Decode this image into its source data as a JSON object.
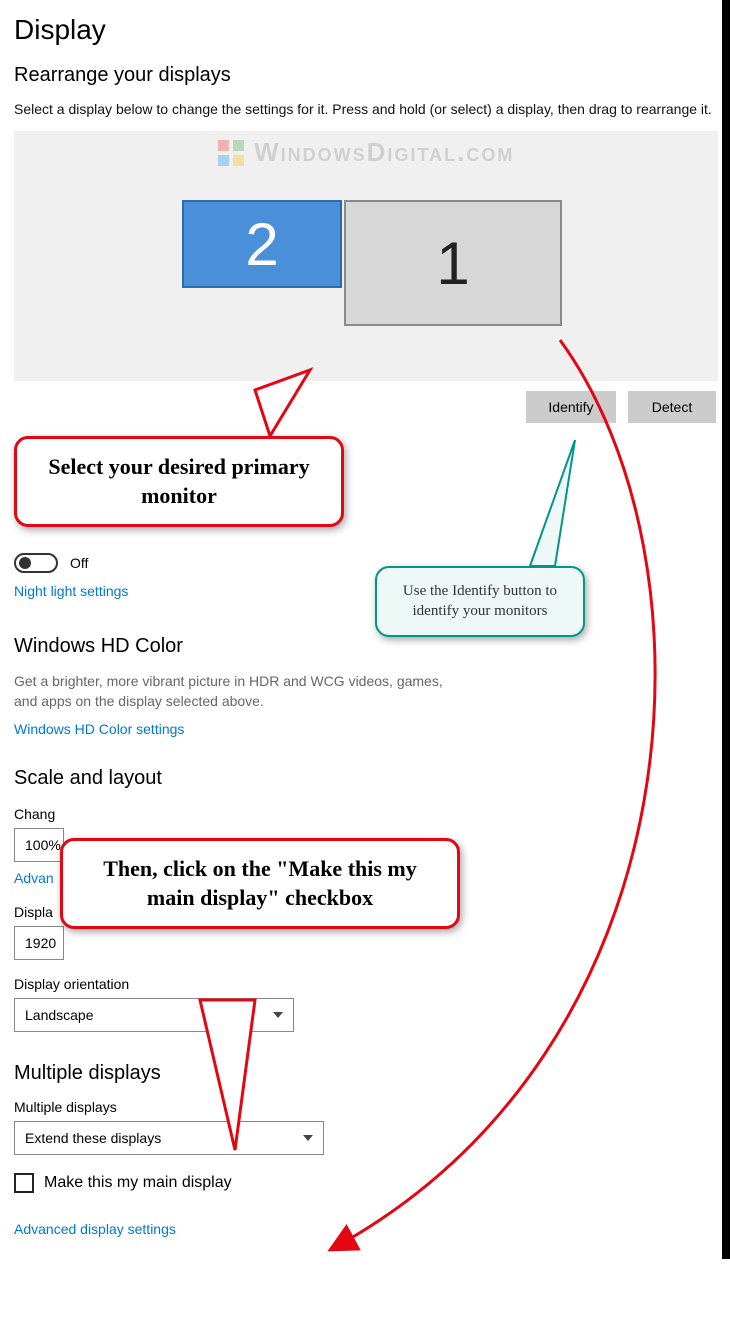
{
  "page": {
    "title": "Display"
  },
  "rearrange": {
    "heading": "Rearrange your displays",
    "instruction": "Select a display below to change the settings for it. Press and hold (or select) a display, then drag to rearrange it.",
    "watermark": "WindowsDigital.com",
    "monitor_selected": "2",
    "monitor_other": "1",
    "identify_btn": "Identify",
    "detect_btn": "Detect"
  },
  "nightlight": {
    "toggle_state": "Off",
    "link": "Night light settings"
  },
  "hdcolor": {
    "heading": "Windows HD Color",
    "desc": "Get a brighter, more vibrant picture in HDR and WCG videos, games, and apps on the display selected above.",
    "link": "Windows HD Color settings"
  },
  "scale": {
    "heading": "Scale and layout",
    "size_label": "Chang",
    "size_value": "100%",
    "adv_scale_link": "Advan",
    "res_label": "Displa",
    "res_value": "1920",
    "orient_label": "Display orientation",
    "orient_value": "Landscape"
  },
  "multi": {
    "heading": "Multiple displays",
    "label": "Multiple displays",
    "value": "Extend these displays",
    "checkbox_label": "Make this my main display",
    "adv_link": "Advanced display settings"
  },
  "callouts": {
    "c1": "Select your desired primary monitor",
    "c2": "Use the Identify button to identify your monitors",
    "c3": "Then, click on the \"Make this my main display\" checkbox"
  }
}
